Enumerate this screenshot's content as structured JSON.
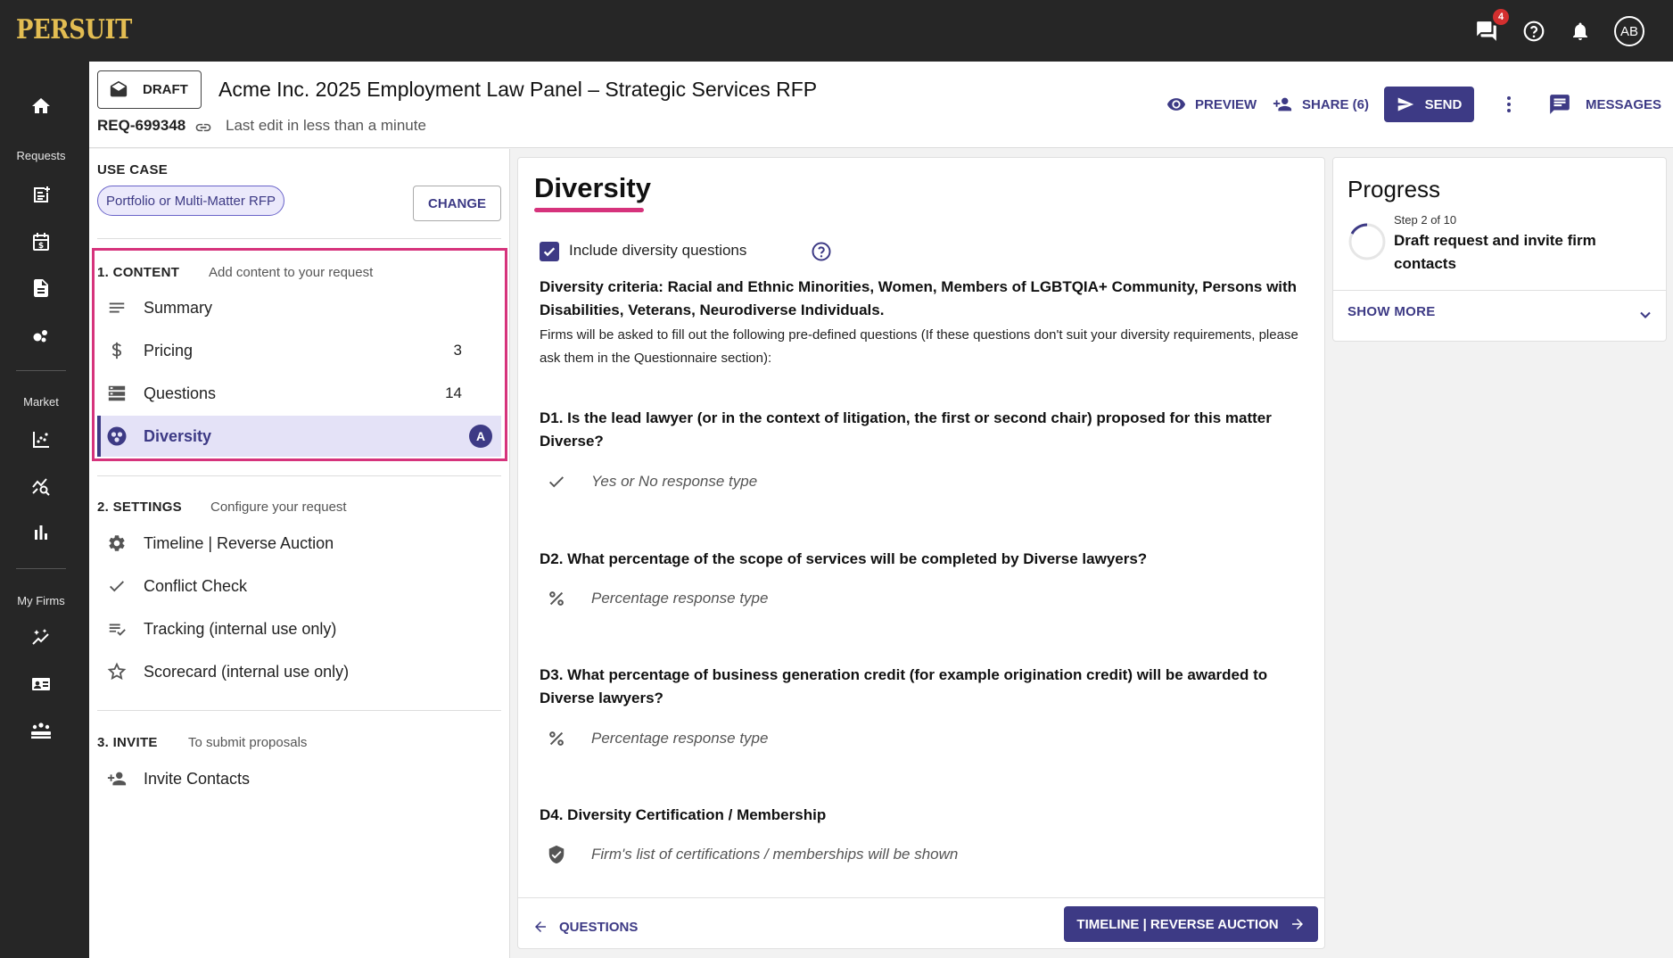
{
  "app": {
    "logo_text": "PERSUIT",
    "messages_badge": "4",
    "avatar_initials": "AB"
  },
  "rail": {
    "requests_label": "Requests",
    "market_label": "Market",
    "myfirms_label": "My Firms"
  },
  "header": {
    "status": "DRAFT",
    "title": "Acme Inc. 2025 Employment Law Panel – Strategic Services RFP",
    "req_id": "REQ-699348",
    "last_edit": "Last edit in less than a minute",
    "preview_label": "PREVIEW",
    "share_label": "SHARE (6)",
    "send_label": "SEND",
    "messages_label": "MESSAGES"
  },
  "sidebar": {
    "use_case_heading": "USE CASE",
    "use_case_value": "Portfolio or Multi-Matter RFP",
    "change_label": "CHANGE",
    "content": {
      "heading": "1. CONTENT",
      "subheading": "Add content to your request",
      "items": [
        {
          "label": "Summary",
          "count": "",
          "icon": "notes-icon"
        },
        {
          "label": "Pricing",
          "count": "3",
          "icon": "dollar-icon"
        },
        {
          "label": "Questions",
          "count": "14",
          "icon": "list-icon"
        },
        {
          "label": "Diversity",
          "count": "",
          "icon": "diversity-icon",
          "badge": "A",
          "active": true
        }
      ]
    },
    "settings": {
      "heading": "2. SETTINGS",
      "subheading": "Configure your request",
      "items": [
        {
          "label": "Timeline | Reverse Auction",
          "icon": "gear-icon"
        },
        {
          "label": "Conflict Check",
          "icon": "check-icon"
        },
        {
          "label": "Tracking (internal use only)",
          "icon": "playlist-check-icon"
        },
        {
          "label": "Scorecard (internal use only)",
          "icon": "star-icon"
        }
      ]
    },
    "invite": {
      "heading": "3. INVITE",
      "subheading": "To submit proposals",
      "items": [
        {
          "label": "Invite Contacts",
          "icon": "person-add-icon"
        }
      ]
    }
  },
  "main": {
    "title": "Diversity",
    "include_label": "Include diversity questions",
    "include_checked": true,
    "criteria": "Diversity criteria: Racial and Ethnic Minorities, Women, Members of LGBTQIA+ Community, Persons with Disabilities, Veterans, Neurodiverse Individuals.",
    "note": "Firms will be asked to fill out the following pre-defined questions (If these questions don't suit your diversity requirements, please ask them in the Questionnaire section):",
    "questions": [
      {
        "title": "D1. Is the lead lawyer (or in the context of litigation, the first or second chair) proposed for this matter Diverse?",
        "response": "Yes or No response type",
        "icon": "check-icon"
      },
      {
        "title": "D2. What percentage of the scope of services will be completed by Diverse lawyers?",
        "response": "Percentage response type",
        "icon": "percent-icon"
      },
      {
        "title": "D3. What percentage of business generation credit (for example origination credit) will be awarded to Diverse lawyers?",
        "response": "Percentage response type",
        "icon": "percent-icon"
      },
      {
        "title": "D4. Diversity Certification / Membership",
        "response": "Firm's list of certifications / memberships will be shown",
        "icon": "shield-check-icon"
      }
    ],
    "back_label": "QUESTIONS",
    "next_label": "TIMELINE | REVERSE AUCTION"
  },
  "progress": {
    "title": "Progress",
    "step": "Step 2 of 10",
    "description": "Draft request and invite firm contacts",
    "show_more": "SHOW MORE"
  },
  "colors": {
    "accent": "#3d3a85",
    "highlight": "#d6337c",
    "logo": "#e3bd52",
    "dark": "#262626"
  }
}
